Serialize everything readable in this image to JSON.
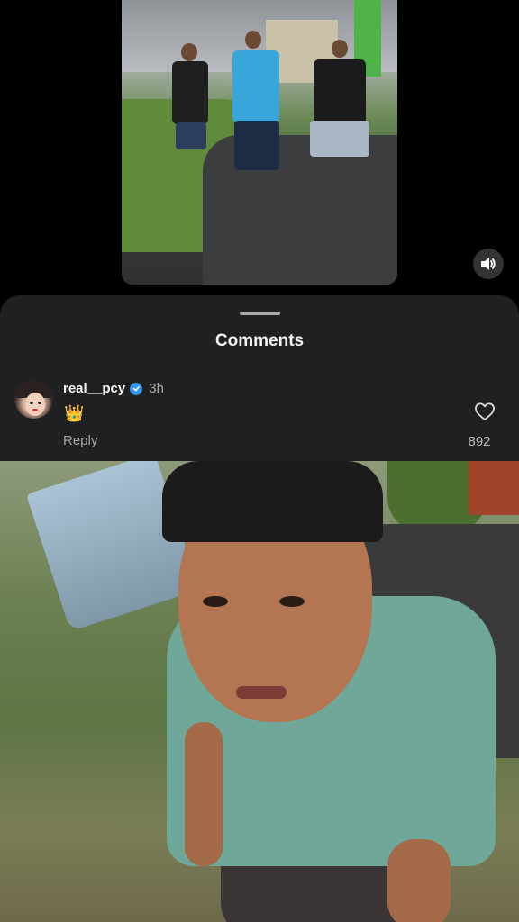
{
  "top_video": {
    "sound_icon": "speaker-icon"
  },
  "comments_sheet": {
    "title": "Comments",
    "comment": {
      "username": "real__pcy",
      "verified": true,
      "timestamp": "3h",
      "text": "👑",
      "reply_label": "Reply",
      "like_count": "892"
    }
  },
  "colors": {
    "sheet_background": "#1f2022",
    "verified_blue": "#3897f0",
    "secondary_text": "#a8a8a8"
  }
}
